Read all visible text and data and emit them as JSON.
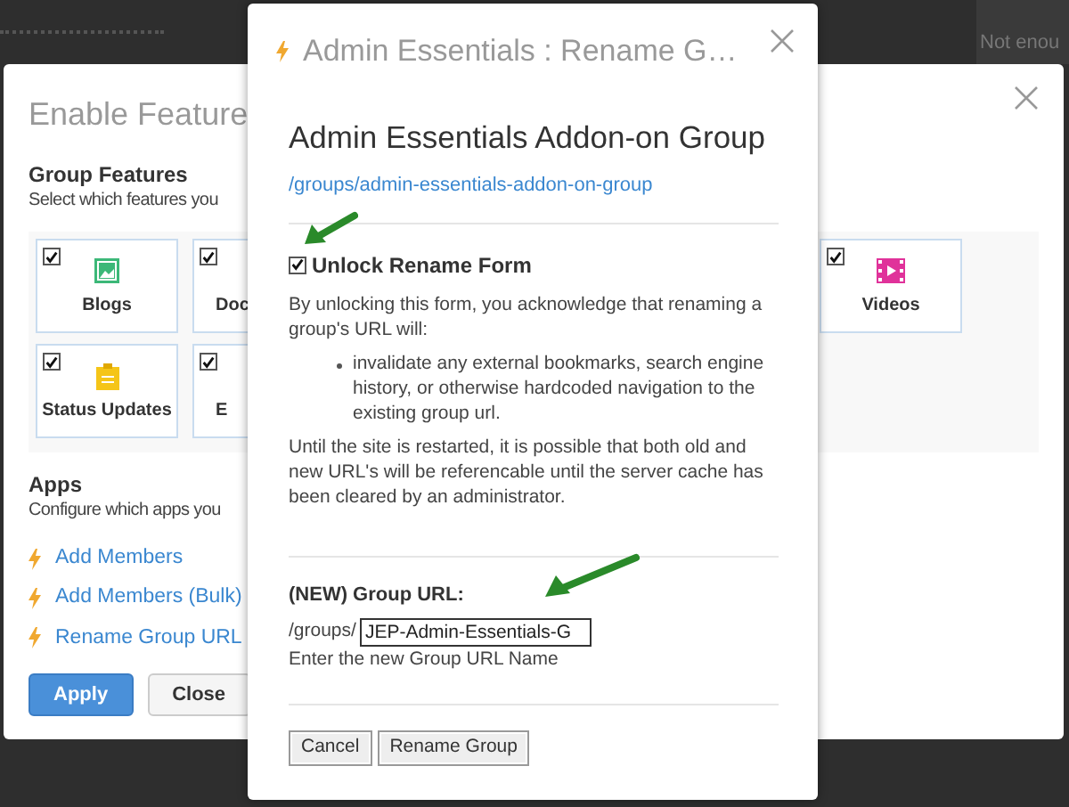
{
  "background_page": {
    "text": "Not enou"
  },
  "features_dialog": {
    "title": "Enable Feature",
    "group_features": {
      "heading": "Group Features",
      "description": "Select which features you",
      "tiles": [
        {
          "label": "Blogs",
          "checked": true,
          "kind": "blogs"
        },
        {
          "label": "Doc",
          "checked": true,
          "kind": "hidden"
        },
        {
          "label": "Videos",
          "checked": true,
          "kind": "videos"
        },
        {
          "label": "Status Updates",
          "checked": true,
          "kind": "status"
        },
        {
          "label": "E",
          "checked": true,
          "kind": "hidden"
        }
      ]
    },
    "apps": {
      "heading": "Apps",
      "description": "Configure which apps you",
      "links": [
        "Add Members",
        "Add Members (Bulk)",
        "Rename Group URL"
      ]
    },
    "buttons": [
      {
        "label": "Apply",
        "kind": "primary"
      },
      {
        "label": "Close",
        "kind": "default"
      }
    ]
  },
  "rename_dialog": {
    "title": "Admin Essentials : Rename G…",
    "group_name": "Admin Essentials Addon-on Group",
    "group_link": "/groups/admin-essentials-addon-on-group",
    "unlock": {
      "label": "Unlock Rename Form",
      "checked": true
    },
    "warning": "By unlocking this form, you acknowledge that renaming a group's URL will:",
    "bullets": [
      "invalidate any external bookmarks, search engine history, or otherwise hardcoded navigation to the existing group url."
    ],
    "note": "Until the site is restarted, it is possible that both old and new URL's will be referencable until the server cache has been cleared by an administrator.",
    "url_label": "(NEW) Group URL:",
    "url_prefix": "/groups/",
    "url_value": "JEP-Admin-Essentials-G",
    "url_hint": "Enter the new Group URL Name",
    "buttons": [
      "Cancel",
      "Rename Group"
    ]
  }
}
